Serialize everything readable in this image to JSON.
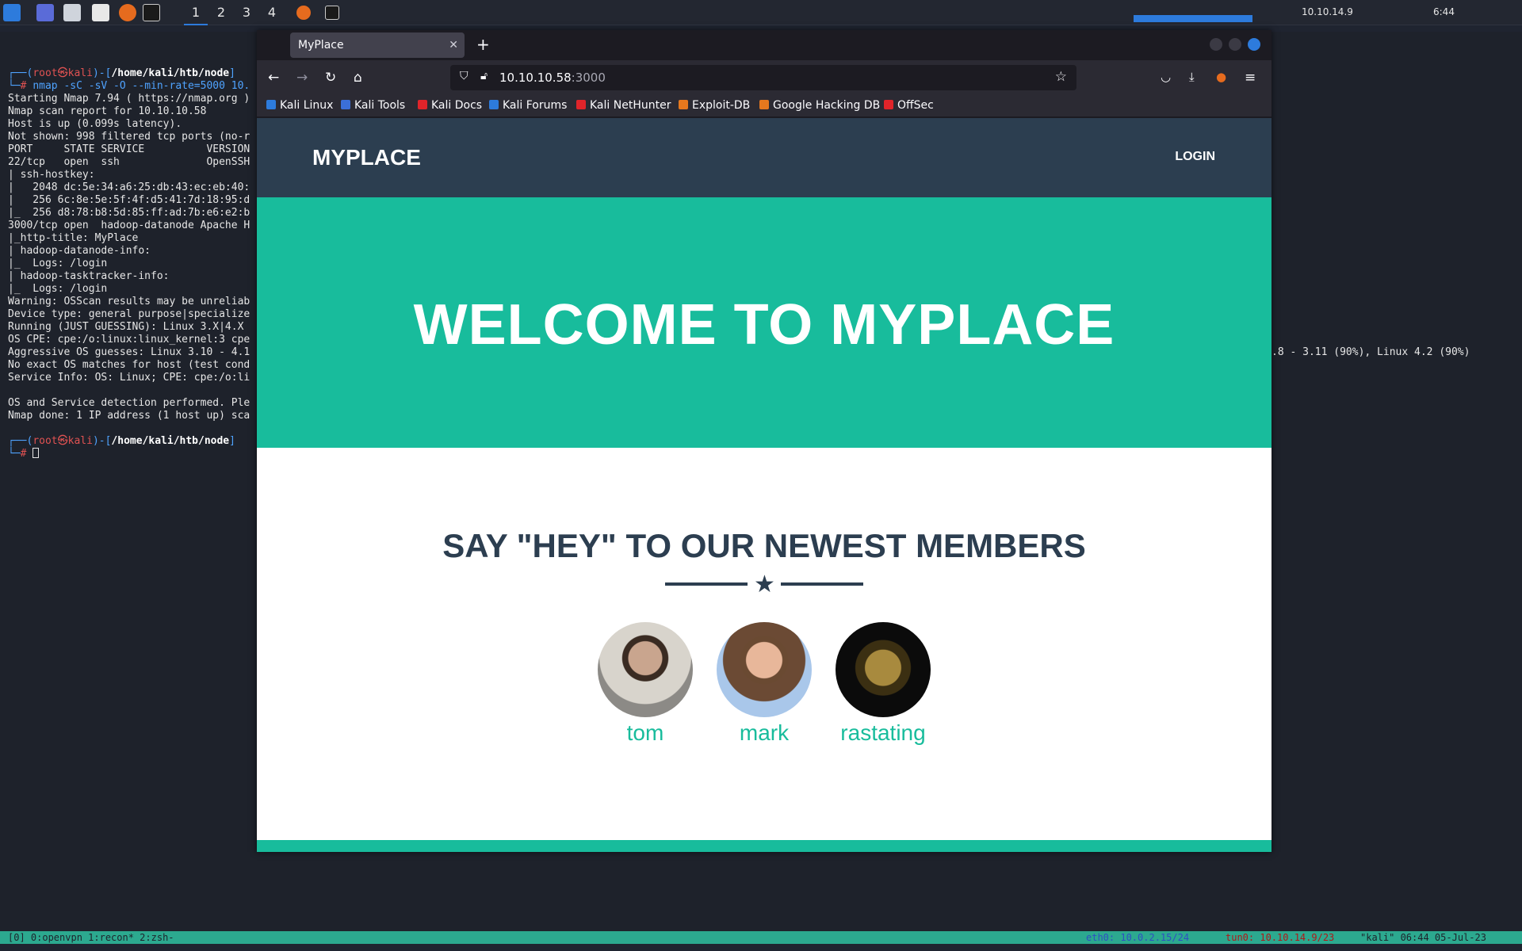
{
  "panel": {
    "workspaces": [
      "1",
      "2",
      "3",
      "4"
    ],
    "vpn_ip": "10.10.14.9",
    "clock": "6:44"
  },
  "terminal": {
    "prompt_user": "root㉿kali",
    "prompt_path": "/home/kali/htb/node",
    "command": "nmap -sC -sV -O --min-rate=5000 10.",
    "lines": [
      "Starting Nmap 7.94 ( https://nmap.org )",
      "Nmap scan report for 10.10.10.58",
      "Host is up (0.099s latency).",
      "Not shown: 998 filtered tcp ports (no-r",
      "PORT     STATE SERVICE          VERSION",
      "22/tcp   open  ssh              OpenSSH",
      "| ssh-hostkey:",
      "|   2048 dc:5e:34:a6:25:db:43:ec:eb:40:",
      "|   256 6c:8e:5e:5f:4f:d5:41:7d:18:95:d",
      "|_  256 d8:78:b8:5d:85:ff:ad:7b:e6:e2:b",
      "3000/tcp open  hadoop-datanode Apache H",
      "|_http-title: MyPlace",
      "| hadoop-datanode-info:",
      "|_  Logs: /login",
      "| hadoop-tasktracker-info:",
      "|_  Logs: /login",
      "Warning: OSScan results may be unreliab",
      "Device type: general purpose|specialize",
      "Running (JUST GUESSING): Linux 3.X|4.X",
      "OS CPE: cpe:/o:linux:linux_kernel:3 cpe",
      "Aggressive OS guesses: Linux 3.10 - 4.1",
      "No exact OS matches for host (test cond",
      "Service Info: OS: Linux; CPE: cpe:/o:li",
      "",
      "OS and Service detection performed. Ple",
      "Nmap done: 1 IP address (1 host up) sca"
    ],
    "right_fragment": ".8 - 3.11 (90%), Linux 4.2 (90%)",
    "prompt_user2": "root㉿kali",
    "prompt_path2": "/home/kali/htb/node",
    "status_left": "[0] 0:openvpn  1:recon* 2:zsh-",
    "status_eth": "eth0: 10.0.2.15/24",
    "status_tun": "tun0: 10.10.14.9/23",
    "status_host": "\"kali\" 06:44 05-Jul-23"
  },
  "browser": {
    "tab_title": "MyPlace",
    "url_host": "10.10.10.58",
    "url_port": ":3000",
    "bookmarks": [
      {
        "label": "Kali Linux",
        "color": "#2d7bdc"
      },
      {
        "label": "Kali Tools",
        "color": "#3b6fd8"
      },
      {
        "label": "Kali Docs",
        "color": "#e0242a"
      },
      {
        "label": "Kali Forums",
        "color": "#2d7bdc"
      },
      {
        "label": "Kali NetHunter",
        "color": "#e0242a"
      },
      {
        "label": "Exploit-DB",
        "color": "#e6781e"
      },
      {
        "label": "Google Hacking DB",
        "color": "#e6781e"
      },
      {
        "label": "OffSec",
        "color": "#e0242a"
      }
    ]
  },
  "site": {
    "brand": "MYPLACE",
    "login": "LOGIN",
    "hero_title": "WELCOME TO MYPLACE",
    "members_title": "SAY \"HEY\" TO OUR NEWEST MEMBERS",
    "members": [
      {
        "name": "tom"
      },
      {
        "name": "mark"
      },
      {
        "name": "rastating"
      }
    ]
  }
}
